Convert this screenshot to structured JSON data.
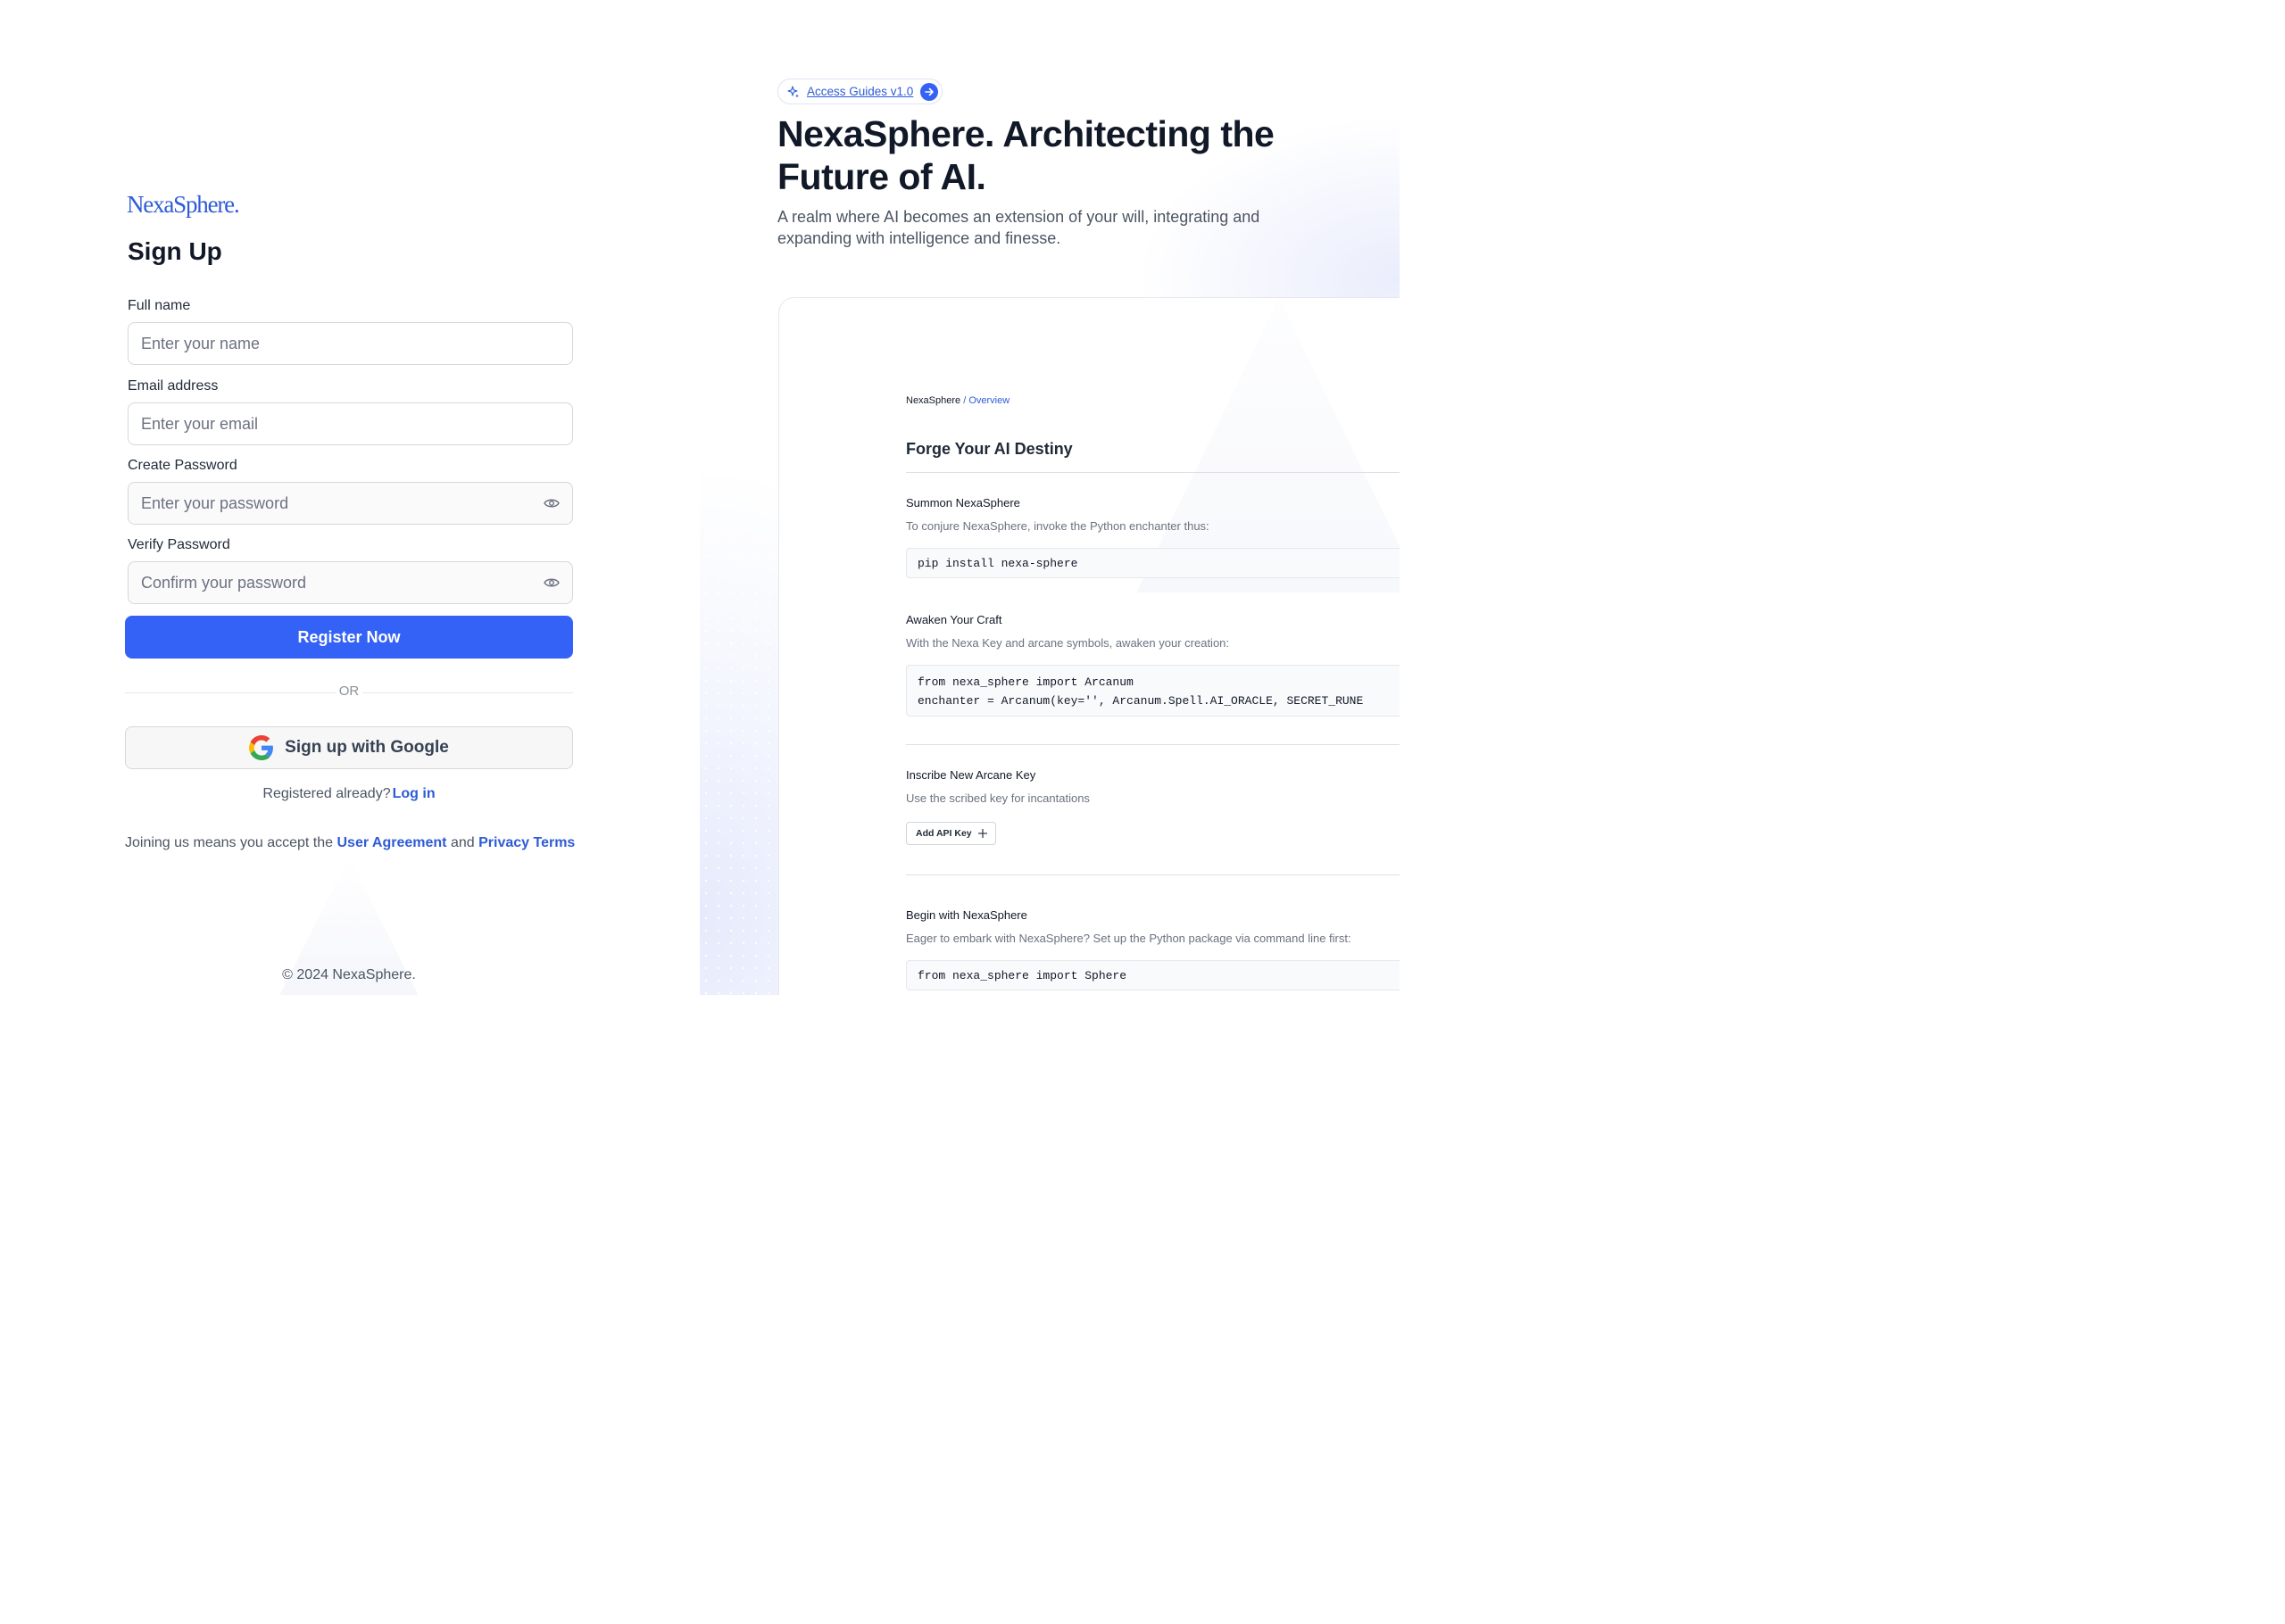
{
  "brand": {
    "logo": "NexaSphere."
  },
  "form": {
    "title": "Sign Up",
    "full_name": {
      "label": "Full name",
      "placeholder": "Enter your name"
    },
    "email": {
      "label": "Email address",
      "placeholder": "Enter your email"
    },
    "password": {
      "label": "Create Password",
      "placeholder": "Enter your password"
    },
    "verify": {
      "label": "Verify Password",
      "placeholder": "Confirm your password"
    },
    "submit_label": "Register Now",
    "or_label": "OR",
    "google_label": "Sign up with Google",
    "already_text": "Registered already?",
    "login_link": "Log in",
    "terms_prefix": "Joining us means you accept the",
    "terms_link": "User Agreement",
    "terms_and": "and",
    "privacy_link": "Privacy Terms"
  },
  "footer": {
    "copyright": "© 2024 NexaSphere."
  },
  "hero": {
    "pill_label": "Access Guides v1.0",
    "headline": "NexaSphere. Architecting the Future of AI.",
    "subtext": "A realm where AI becomes an extension of your will, integrating and expanding with intelligence and finesse."
  },
  "preview": {
    "breadcrumb_root": "NexaSphere",
    "breadcrumb_sep": "/",
    "breadcrumb_current": "Overview",
    "heading": "Forge Your AI Destiny",
    "sections": [
      {
        "title": "Summon NexaSphere",
        "desc": "To conjure NexaSphere, invoke the Python enchanter thus:",
        "code": "pip install nexa-sphere"
      },
      {
        "title": "Awaken Your Craft",
        "desc": "With the Nexa Key and arcane symbols, awaken your creation:",
        "code": "from nexa_sphere import Arcanum\nenchanter = Arcanum(key='', Arcanum.Spell.AI_ORACLE, SECRET_RUNE"
      },
      {
        "title": "Inscribe New Arcane Key",
        "desc": "Use the scribed key for incantations",
        "button": "Add API Key"
      },
      {
        "title": "Begin with NexaSphere",
        "desc": "Eager to embark with NexaSphere? Set up the Python package via command line first:",
        "code": "from nexa_sphere import Sphere"
      }
    ]
  },
  "colors": {
    "accent": "#3462f6",
    "link": "#2f5bd6",
    "text": "#111827",
    "muted": "#6b7280"
  },
  "icons": [
    "eye-icon",
    "google-icon",
    "sparkle-icon",
    "arrow-right-icon",
    "plus-icon"
  ]
}
